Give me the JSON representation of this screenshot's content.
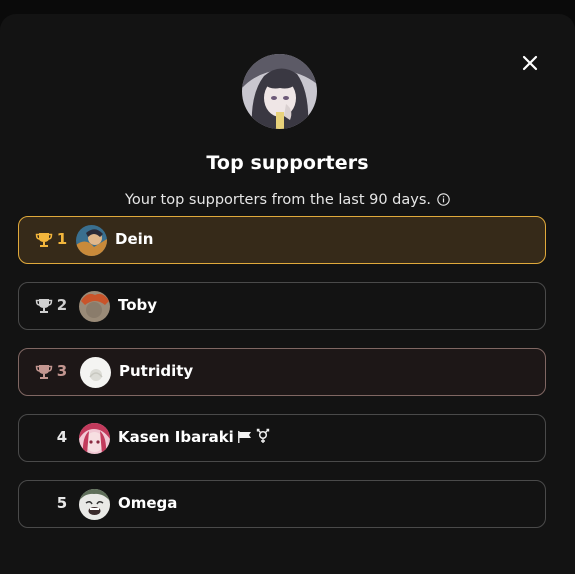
{
  "modal": {
    "title": "Top supporters",
    "subtitle": "Your top supporters from the last 90 days."
  },
  "icons": {
    "close": "close-icon",
    "info": "info-icon",
    "trophy": "trophy-icon"
  },
  "colors": {
    "gold": "#f3b63c",
    "silver": "#cfcfcf",
    "bronze": "#c39690"
  },
  "supporters": [
    {
      "rank": "1",
      "name": "Dein"
    },
    {
      "rank": "2",
      "name": "Toby"
    },
    {
      "rank": "3",
      "name": "Putridity"
    },
    {
      "rank": "4",
      "name": "Kasen Ibaraki"
    },
    {
      "rank": "5",
      "name": "Omega"
    }
  ]
}
